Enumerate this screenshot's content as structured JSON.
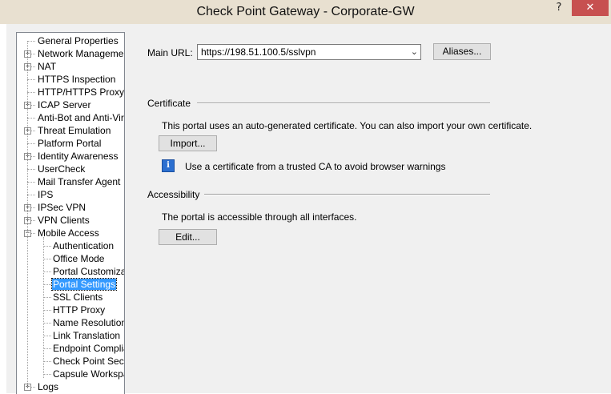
{
  "window": {
    "title": "Check Point Gateway - Corporate-GW",
    "help_glyph": "?",
    "close_glyph": "✕"
  },
  "tree": {
    "items": [
      {
        "label": "General Properties",
        "expandable": false,
        "level": 0
      },
      {
        "label": "Network Management",
        "expandable": true,
        "level": 0
      },
      {
        "label": "NAT",
        "expandable": true,
        "level": 0
      },
      {
        "label": "HTTPS Inspection",
        "expandable": false,
        "level": 0
      },
      {
        "label": "HTTP/HTTPS Proxy",
        "expandable": false,
        "level": 0
      },
      {
        "label": "ICAP Server",
        "expandable": true,
        "level": 0
      },
      {
        "label": "Anti-Bot and Anti-Virus",
        "expandable": false,
        "level": 0
      },
      {
        "label": "Threat Emulation",
        "expandable": true,
        "level": 0
      },
      {
        "label": "Platform Portal",
        "expandable": false,
        "level": 0
      },
      {
        "label": "Identity Awareness",
        "expandable": true,
        "level": 0
      },
      {
        "label": "UserCheck",
        "expandable": false,
        "level": 0
      },
      {
        "label": "Mail Transfer Agent",
        "expandable": false,
        "level": 0
      },
      {
        "label": "IPS",
        "expandable": false,
        "level": 0
      },
      {
        "label": "IPSec VPN",
        "expandable": true,
        "level": 0
      },
      {
        "label": "VPN Clients",
        "expandable": true,
        "level": 0
      },
      {
        "label": "Mobile Access",
        "expandable": true,
        "expanded": true,
        "level": 0
      },
      {
        "label": "Authentication",
        "expandable": false,
        "level": 1
      },
      {
        "label": "Office Mode",
        "expandable": false,
        "level": 1
      },
      {
        "label": "Portal Customizatio",
        "expandable": false,
        "level": 1
      },
      {
        "label": "Portal Settings",
        "expandable": false,
        "level": 1,
        "selected": true
      },
      {
        "label": "SSL Clients",
        "expandable": false,
        "level": 1
      },
      {
        "label": "HTTP Proxy",
        "expandable": false,
        "level": 1
      },
      {
        "label": "Name Resolution",
        "expandable": false,
        "level": 1
      },
      {
        "label": "Link Translation",
        "expandable": false,
        "level": 1
      },
      {
        "label": "Endpoint Complian",
        "expandable": false,
        "level": 1
      },
      {
        "label": "Check Point Secur",
        "expandable": false,
        "level": 1
      },
      {
        "label": "Capsule Workspac",
        "expandable": false,
        "level": 1
      },
      {
        "label": "Logs",
        "expandable": true,
        "level": 0
      }
    ]
  },
  "main": {
    "url_label": "Main URL:",
    "url_value": "https://198.51.100.5/sslvpn",
    "aliases_button": "Aliases...",
    "certificate": {
      "title": "Certificate",
      "description": "This portal uses an auto-generated certificate. You can also import your own certificate.",
      "import_button": "Import...",
      "info_glyph": "i",
      "info_text": "Use a certificate from a trusted CA to avoid browser warnings"
    },
    "accessibility": {
      "title": "Accessibility",
      "description": "The portal is accessible through all interfaces.",
      "edit_button": "Edit..."
    }
  }
}
